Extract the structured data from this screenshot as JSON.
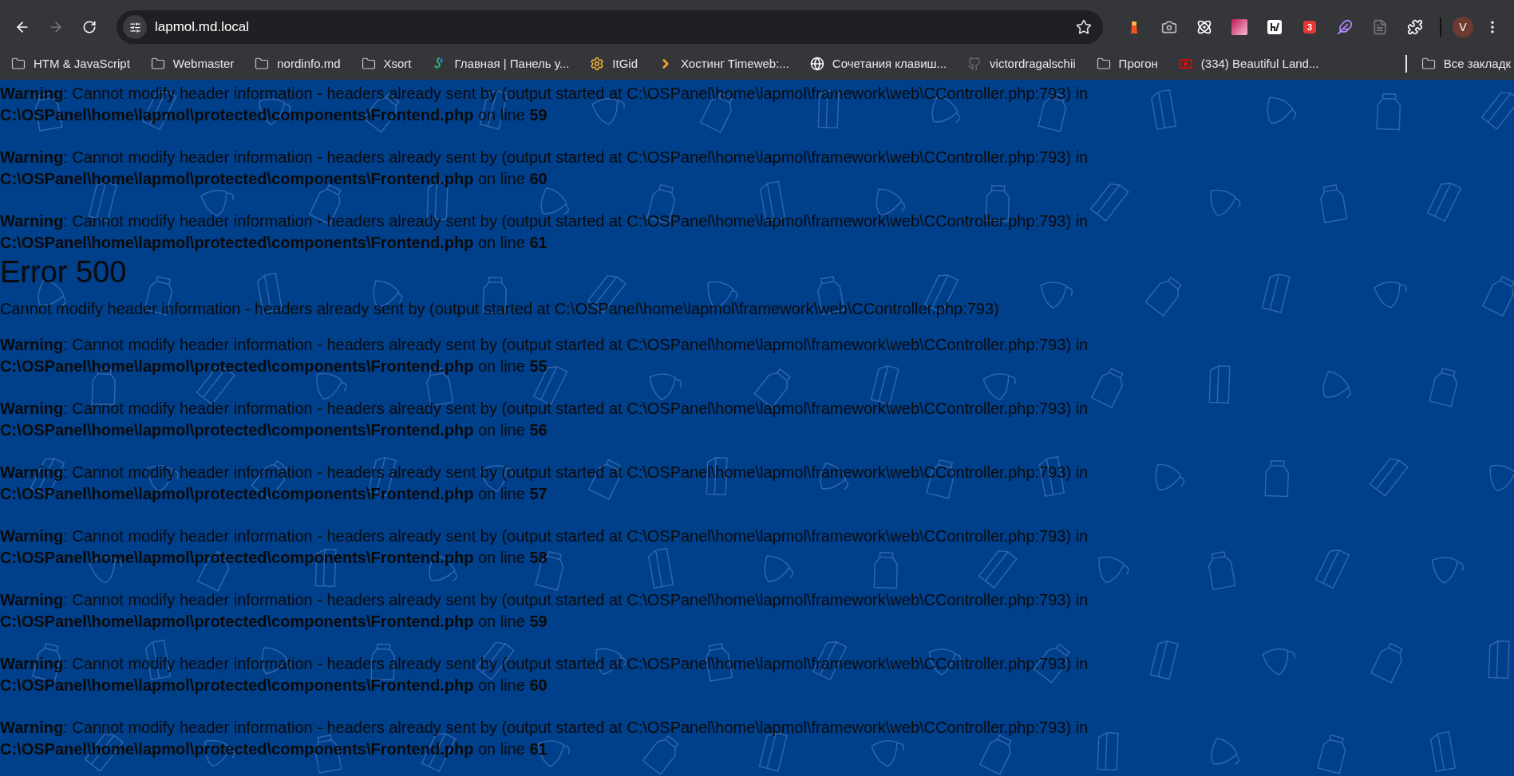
{
  "browser": {
    "url": "lapmol.md.local",
    "forward_disabled": true,
    "extensions": [
      {
        "kind": "lighthouse"
      },
      {
        "kind": "camera"
      },
      {
        "kind": "atom"
      },
      {
        "kind": "gradient"
      },
      {
        "kind": "hslash"
      },
      {
        "kind": "tag",
        "badge": "3"
      },
      {
        "kind": "feather"
      },
      {
        "kind": "doc"
      },
      {
        "kind": "puzzle"
      }
    ],
    "profile": "V",
    "bookmarks": [
      {
        "kind": "folder",
        "label": "HTM & JavaScript"
      },
      {
        "kind": "folder",
        "label": "Webmaster"
      },
      {
        "kind": "folder",
        "label": "nordinfo.md"
      },
      {
        "kind": "folder",
        "label": "Xsort"
      },
      {
        "kind": "swirl",
        "label": "Главная | Панель у..."
      },
      {
        "kind": "gear",
        "label": "ItGid"
      },
      {
        "kind": "chevron",
        "label": "Хостинг Timeweb:..."
      },
      {
        "kind": "globe",
        "label": "Сочетания клавиш..."
      },
      {
        "kind": "github",
        "label": "victordragalschii"
      },
      {
        "kind": "folder",
        "label": "Прогон"
      },
      {
        "kind": "youtube",
        "label": "(334) Beautiful Land..."
      }
    ],
    "all_bookmarks": "Все закладк"
  },
  "page": [
    {
      "kind": "warning",
      "text": "**Warning**: Cannot modify header information - headers already sent by (output started at C:\\OSPanel\\home\\lapmol\\framework\\web\\CController.php:793) in",
      "location": "**C:\\OSPanel\\home\\lapmol\\protected\\components\\Frontend.php** on line **59**"
    },
    {
      "kind": "warning",
      "text": "**Warning**: Cannot modify header information - headers already sent by (output started at C:\\OSPanel\\home\\lapmol\\framework\\web\\CController.php:793) in",
      "location": "**C:\\OSPanel\\home\\lapmol\\protected\\components\\Frontend.php** on line **60**"
    },
    {
      "kind": "warning",
      "text": "**Warning**: Cannot modify header information - headers already sent by (output started at C:\\OSPanel\\home\\lapmol\\framework\\web\\CController.php:793) in",
      "location": "**C:\\OSPanel\\home\\lapmol\\protected\\components\\Frontend.php** on line **61**"
    },
    {
      "kind": "heading",
      "text": "Error 500"
    },
    {
      "kind": "message",
      "text": "Cannot modify header information - headers already sent by (output started at C:\\OSPanel\\home\\lapmol\\framework\\web\\CController.php:793)"
    },
    {
      "kind": "warning",
      "text": "**Warning**: Cannot modify header information - headers already sent by (output started at C:\\OSPanel\\home\\lapmol\\framework\\web\\CController.php:793) in",
      "location": "**C:\\OSPanel\\home\\lapmol\\protected\\components\\Frontend.php** on line **55**"
    },
    {
      "kind": "warning",
      "text": "**Warning**: Cannot modify header information - headers already sent by (output started at C:\\OSPanel\\home\\lapmol\\framework\\web\\CController.php:793) in",
      "location": "**C:\\OSPanel\\home\\lapmol\\protected\\components\\Frontend.php** on line **56**"
    },
    {
      "kind": "warning",
      "text": "**Warning**: Cannot modify header information - headers already sent by (output started at C:\\OSPanel\\home\\lapmol\\framework\\web\\CController.php:793) in",
      "location": "**C:\\OSPanel\\home\\lapmol\\protected\\components\\Frontend.php** on line **57**"
    },
    {
      "kind": "warning",
      "text": "**Warning**: Cannot modify header information - headers already sent by (output started at C:\\OSPanel\\home\\lapmol\\framework\\web\\CController.php:793) in",
      "location": "**C:\\OSPanel\\home\\lapmol\\protected\\components\\Frontend.php** on line **58**"
    },
    {
      "kind": "warning",
      "text": "**Warning**: Cannot modify header information - headers already sent by (output started at C:\\OSPanel\\home\\lapmol\\framework\\web\\CController.php:793) in",
      "location": "**C:\\OSPanel\\home\\lapmol\\protected\\components\\Frontend.php** on line **59**"
    },
    {
      "kind": "warning",
      "text": "**Warning**: Cannot modify header information - headers already sent by (output started at C:\\OSPanel\\home\\lapmol\\framework\\web\\CController.php:793) in",
      "location": "**C:\\OSPanel\\home\\lapmol\\protected\\components\\Frontend.php** on line **60**"
    },
    {
      "kind": "warning",
      "text": "**Warning**: Cannot modify header information - headers already sent by (output started at C:\\OSPanel\\home\\lapmol\\framework\\web\\CController.php:793) in",
      "location": "**C:\\OSPanel\\home\\lapmol\\protected\\components\\Frontend.php** on line **61**"
    }
  ]
}
